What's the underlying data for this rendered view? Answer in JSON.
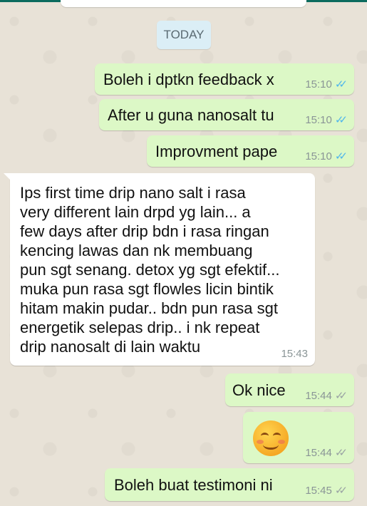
{
  "chat": {
    "date_divider": "TODAY",
    "messages": [
      {
        "text": "Boleh i dptkn feedback x",
        "time": "15:10",
        "status": "read-icon"
      },
      {
        "text": "After u guna nanosalt tu",
        "time": "15:10",
        "status": "read-icon"
      },
      {
        "text": "Improvment pape",
        "time": "15:10",
        "status": "read-icon"
      },
      {
        "lines": [
          "Ips first time drip nano salt i rasa",
          "very different lain drpd yg lain... a",
          "few days after drip bdn i rasa ringan",
          "kencing lawas dan nk membuang",
          "pun sgt senang. detox yg sgt efektif...",
          "muka pun rasa sgt flowles licin bintik",
          "hitam makin pudar.. bdn pun rasa sgt",
          "energetik selepas drip.. i nk repeat",
          "drip nanosalt di lain waktu"
        ],
        "time": "15:43"
      },
      {
        "text": "Ok nice",
        "time": "15:44",
        "status": "delivered-icon"
      },
      {
        "emoji": "smiling-face-with-smiling-eyes",
        "time": "15:44",
        "status": "delivered-icon"
      },
      {
        "text": "Boleh buat testimoni ni",
        "time": "15:45",
        "status": "delivered-icon"
      }
    ]
  },
  "colors": {
    "outgoing_bubble": "#dcf8c6",
    "incoming_bubble": "#ffffff",
    "read_tick": "#4fb6ec",
    "delivered_tick": "#9aa3a4",
    "wallpaper": "#e8e2d7"
  }
}
